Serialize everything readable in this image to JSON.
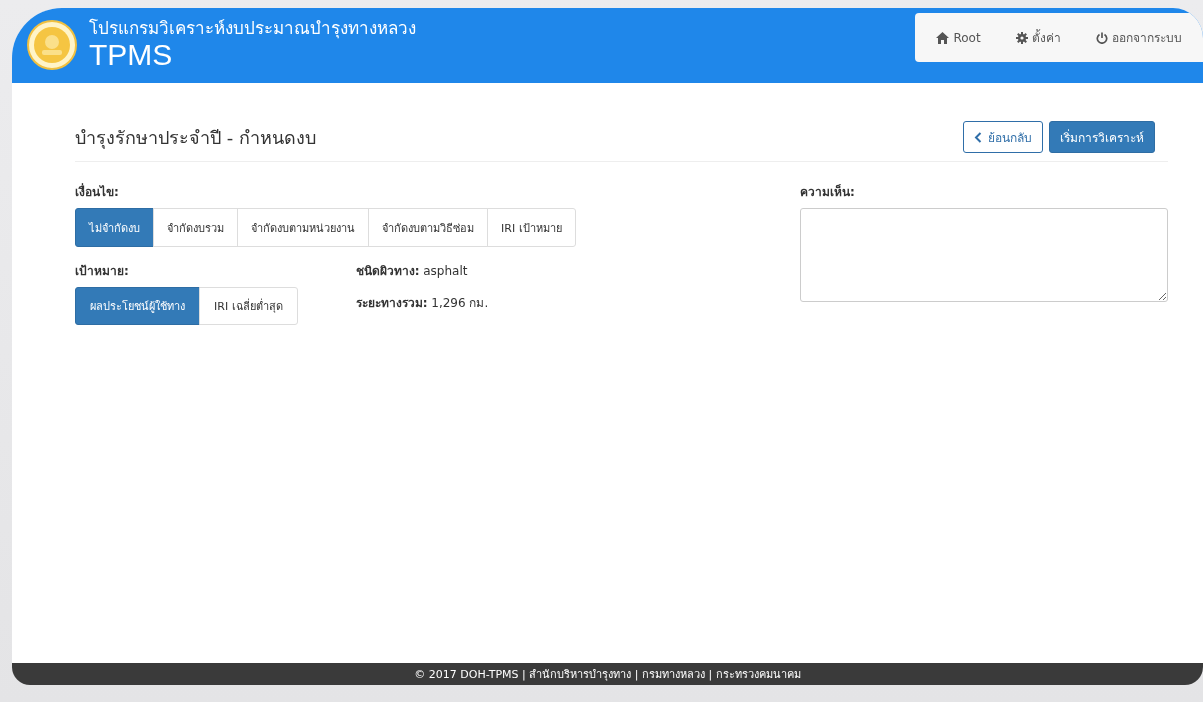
{
  "header": {
    "subtitle": "โปรแกรมวิเคราะห์งบประมาณบำรุงทางหลวง",
    "title": "TPMS"
  },
  "nav": [
    {
      "label": "Root",
      "kind": "home"
    },
    {
      "label": "ตั้งค่า",
      "kind": "settings"
    },
    {
      "label": "ออกจากระบบ",
      "kind": "logout"
    }
  ],
  "page_title": "บำรุงรักษาประจำปี - กำหนดงบ",
  "actions": [
    {
      "label": "ย้อนกลับ",
      "kind": "back"
    },
    {
      "label": "เริ่มการวิเคราะห์",
      "kind": "primary"
    }
  ],
  "condition": {
    "label": "เงื่อนไข:",
    "options": [
      {
        "label": "ไม่จำกัดงบ",
        "selected": true
      },
      {
        "label": "จำกัดงบรวม",
        "selected": false
      },
      {
        "label": "จำกัดงบตามหน่วยงาน",
        "selected": false
      },
      {
        "label": "จำกัดงบตามวิธีซ่อม",
        "selected": false
      },
      {
        "label": "IRI เป้าหมาย",
        "selected": false
      }
    ]
  },
  "target": {
    "label": "เป้าหมาย:",
    "options": [
      {
        "label": "ผลประโยชน์ผู้ใช้ทาง",
        "selected": true
      },
      {
        "label": "IRI เฉลี่ยต่ำสุด",
        "selected": false
      }
    ]
  },
  "info": [
    "**ชนิดผิวทาง:** asphalt",
    "**ระยะทางรวม:** 1,296 กม."
  ],
  "comment": {
    "label": "ความเห็น:"
  },
  "footer": "© 2017 DOH-TPMS | สำนักบริหารบำรุงทาง | กรมทางหลวง | กระทรวงคมนาคม"
}
